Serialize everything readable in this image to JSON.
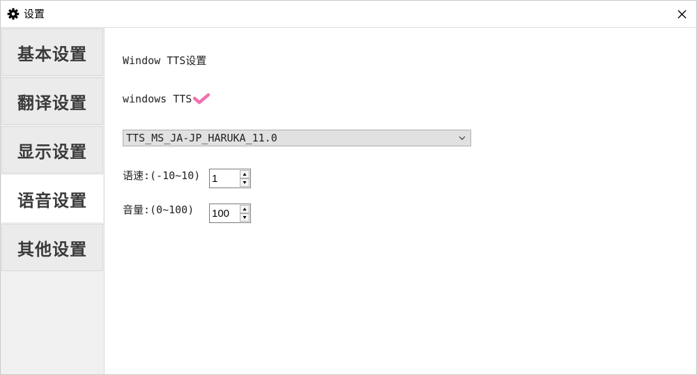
{
  "window": {
    "title": "设置",
    "icon": "gear-icon",
    "close_icon": "close-icon"
  },
  "sidebar": {
    "items": [
      {
        "label": "基本设置",
        "active": false
      },
      {
        "label": "翻译设置",
        "active": false
      },
      {
        "label": "显示设置",
        "active": false
      },
      {
        "label": "语音设置",
        "active": true
      },
      {
        "label": "其他设置",
        "active": false
      }
    ]
  },
  "tts": {
    "section_title": "Window TTS设置",
    "toggle_label": "windows TTS",
    "toggle_checked": true,
    "check_color": "#f070b0",
    "voice_selected": "TTS_MS_JA-JP_HARUKA_11.0",
    "speed_label": "语速:(-10~10)",
    "speed_value": "1",
    "volume_label": "音量:(0~100)",
    "volume_value": "100"
  }
}
